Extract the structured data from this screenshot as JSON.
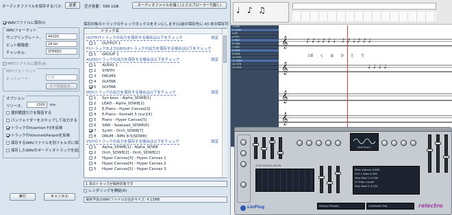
{
  "dialog": {
    "path_label": "オーディオファイルを保存するパス:",
    "change_btn": "変更",
    "free_space": "空き容量：588.1GB",
    "open_folder_btn": "オーディオファイルを開く(エクスプローラーで開く)",
    "wav_checkbox": "WAVファイルに保存(I)",
    "wav_format": {
      "title": "WAVフォーマット",
      "rate_label": "サンプリングレート:",
      "rate_value": "44100",
      "bits_label": "ビット解像度:",
      "bits_value": "24 bit",
      "channel_label": "チャンネル:",
      "channel_value": "STEREO"
    },
    "mp3_checkbox": "MP3ファイルに保存(A)",
    "mp3_format": {
      "title": "MP3フォーマット",
      "bitrate_label": "ビットレート:",
      "bitrate_value": "128",
      "tag_btn": "タグ情報設定..."
    },
    "options": {
      "title": "オプション",
      "release_label": "リリース:",
      "release_value": "2000",
      "release_unit": "ms",
      "items": [
        {
          "label": "選択範囲だけを録音する",
          "on": false
        },
        {
          "label": "パンフェイダーをスキップして出力する",
          "on": false
        },
        {
          "label": "トラックのInsertion FXを反映",
          "on": true
        },
        {
          "label": "トラックのVolume&Panpotを反映",
          "on": true
        },
        {
          "label": "保存するWAVファイルを別フォルダに保存",
          "on": false
        },
        {
          "label": "保存したWAVのオーディオトラックを追加",
          "on": false
        }
      ]
    },
    "instructions": "保存対象のトラックのチェックボックスをオンにします(以前の保存先に 43 本の保存可能なトラックがあります)",
    "list_header": "トラック名",
    "sections": [
      {
        "title": "OUTPUTトラックの出力を保存する場合は以下をチェック",
        "link": "設定",
        "rows": [
          {
            "n": "1",
            "name": "OUTPUT 1",
            "on": false
          }
        ]
      },
      {
        "title": "FXトラックおよびGROUPトラックの出力を保存する場合は以下をチェック",
        "link": "設定",
        "rows": [
          {
            "n": "1",
            "name": "GROUP 1",
            "on": false
          }
        ]
      },
      {
        "title": "AUDIOトラックの出力を保存する場合は以下をチェック",
        "link": "設定",
        "rows": [
          {
            "n": "1",
            "name": "AUDIO 1",
            "on": false
          },
          {
            "n": "2",
            "name": "SYNTH",
            "on": false
          },
          {
            "n": "3",
            "name": "DRUMS",
            "on": false
          },
          {
            "n": "4",
            "name": "GUITAR",
            "on": false
          },
          {
            "n": "5",
            "name": "GUITAR",
            "on": true
          }
        ]
      },
      {
        "title": "MIDIトラックの出力を保存する場合は以下をチェック",
        "link": "設定",
        "rows": [
          {
            "n": "1",
            "name": "Syn bass - Alpha_SDW8[1]",
            "on": false
          },
          {
            "n": "2",
            "name": "LEAD - Alpha_SDW8[2]",
            "on": false
          },
          {
            "n": "3",
            "name": "E.Piano - Hyper Canvas[3]",
            "on": false
          },
          {
            "n": "4",
            "name": "E.Piano - Kontakt 5 (sur)[4]",
            "on": false
          },
          {
            "n": "5",
            "name": "Piano - Hyper Canvas[5]",
            "on": false
          },
          {
            "n": "6",
            "name": "SAW - SawLead_SDW8[6]",
            "on": false
          },
          {
            "n": "7",
            "name": "Synth - Orch_SDW8[7]",
            "on": true
          },
          {
            "n": "8",
            "name": "DRUM - RMV 8-5[SDW8]",
            "on": false
          }
        ]
      },
      {
        "title": "VSTiのトラックの出力を保存する場合は以下をチェック",
        "link": "設定",
        "rows": [
          {
            "n": "1",
            "name": "Alpha_SDW8[1] - Alpha_SDW8",
            "on": false
          },
          {
            "n": "2",
            "name": "Orch_SDW8[2] - Orch_SDW8[2]",
            "on": false
          },
          {
            "n": "3",
            "name": "Hyper Canvas[3] - Hyper Canvas 1",
            "on": false
          },
          {
            "n": "4",
            "name": "Hyper Canvas[4] - Hyper Canvas 2",
            "on": false
          },
          {
            "n": "5",
            "name": "Hyper Canvas[5] - Hyper Canvas 3",
            "on": false
          }
        ]
      }
    ],
    "status1": "1 本のトラックが保存対象です",
    "single_label": "レンダリングを開始(R)",
    "status3": "保存予定のWAVファイルの合計サイズ: 4.13MB",
    "run_btn": "実行",
    "cancel_btn": "キャンセル"
  },
  "daw": {
    "tracks": [
      "1 SYN",
      "2 LEAD",
      "3 EP",
      "4 EPn",
      "5 PNO",
      "6 SAW",
      "7 ORC",
      "8 DRM",
      "9 AUD",
      "10 SYN",
      "11 DRM",
      "12 GTR",
      "13 GTR"
    ],
    "lyrics": [
      "♪ぼ",
      "く",
      "は",
      "ひ",
      "と",
      "り"
    ],
    "toolbar_icons": [
      "whole-note-icon",
      "half-note-icon",
      "quarter-note-icon"
    ]
  },
  "synth": {
    "sections": [
      "MOD",
      "ENV",
      "FILTER",
      "OSC",
      "LFO",
      "DELAY",
      "EFFECTS",
      "CHORUS"
    ],
    "preset_label": "Factory Presets",
    "preset_name": "Cinematic Pad",
    "lcd_lines": [
      "Main Volume  0.828",
      "LFO 1 Rate   0.500",
      "Step Mod 1   0.238",
      "LP Filter Cutoff",
      "Step Mod 2   0.120"
    ],
    "brand": "LinPlug",
    "product": "relectro",
    "display_name": "Sine Plus 1",
    "tabs": [
      "STEP MODULATION",
      "SYNC"
    ],
    "colors": {
      "accent": "#2c56b4",
      "brand": "#a0409e"
    }
  }
}
